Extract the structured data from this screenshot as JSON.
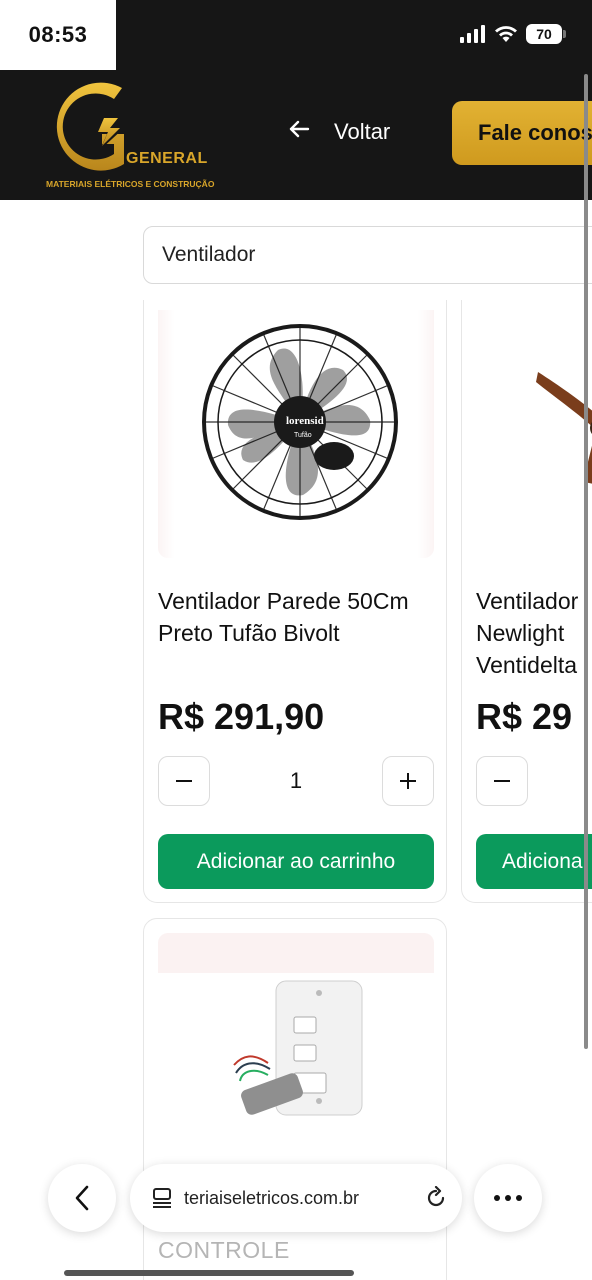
{
  "status_bar": {
    "time": "08:53",
    "battery": "70"
  },
  "header": {
    "logo_text": "GENERAL",
    "logo_subtitle": "MATERIAIS ELÉTRICOS E CONSTRUÇÃO",
    "back_label": "Voltar",
    "contact_label": "Fale conos"
  },
  "search": {
    "value": "Ventilador"
  },
  "products": [
    {
      "name": "Ventilador Parede 50Cm Preto Tufão Bivolt",
      "price": "R$ 291,90",
      "quantity": "1",
      "add_label": "Adicionar ao carrinho",
      "image_brand": "lorensid",
      "image_model": "Tufão"
    },
    {
      "name": "Ventilador Newlight Ventidelta",
      "price": "R$ 29",
      "add_label": "Adiciona"
    },
    {
      "name": "CONTROLE"
    }
  ],
  "browser": {
    "url": "teriaiseletricos.com.br"
  },
  "colors": {
    "header_bg": "#161616",
    "accent_gold": "#d9a62a",
    "add_button": "#0b9a5c"
  }
}
